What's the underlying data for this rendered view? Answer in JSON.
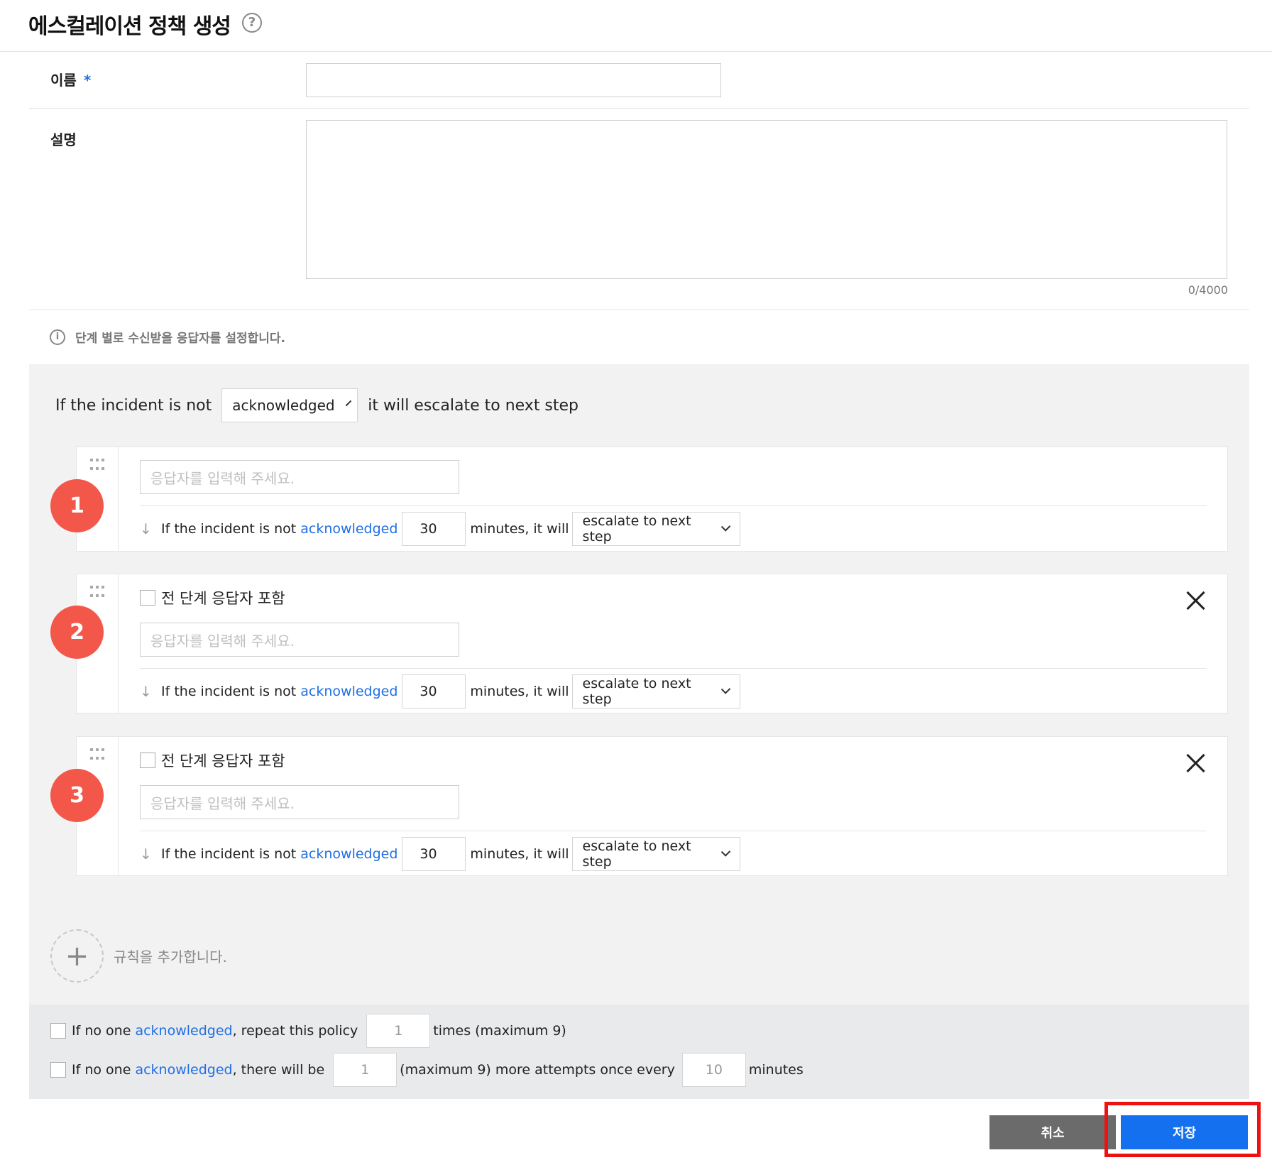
{
  "header": {
    "title": "에스컬레이션 정책 생성",
    "help_icon": "?"
  },
  "form": {
    "name_label": "이름",
    "required_mark": "*",
    "name_value": "",
    "description_label": "설명",
    "description_value": "",
    "char_counter": "0/4000"
  },
  "info": {
    "icon": "i",
    "text": "단계 별로 수신받을 응답자를 설정합니다."
  },
  "policy": {
    "prefix": "If the incident is not",
    "condition_select": "acknowledged",
    "suffix": "it will escalate to next step"
  },
  "steps": [
    {
      "number": "1",
      "responder_placeholder": "응답자를 입력해 주세요.",
      "rule_prefix": "If the incident is not",
      "rule_link": "acknowledged",
      "minutes": "30",
      "rule_middle": "minutes, it will",
      "action": "escalate to next step"
    },
    {
      "number": "2",
      "include_prev_label": "전 단계 응답자 포함",
      "responder_placeholder": "응답자를 입력해 주세요.",
      "rule_prefix": "If the incident is not",
      "rule_link": "acknowledged",
      "minutes": "30",
      "rule_middle": "minutes, it will",
      "action": "escalate to next step"
    },
    {
      "number": "3",
      "include_prev_label": "전 단계 응답자 포함",
      "responder_placeholder": "응답자를 입력해 주세요.",
      "rule_prefix": "If the incident is not",
      "rule_link": "acknowledged",
      "minutes": "30",
      "rule_middle": "minutes, it will",
      "action": "escalate to next step"
    }
  ],
  "add_rule": {
    "icon": "+",
    "label": "규칙을 추가합니다."
  },
  "repeat": {
    "line1_prefix": "If no one",
    "line1_link": "acknowledged",
    "line1_middle": ", repeat this policy",
    "line1_value": "1",
    "line1_suffix": "times (maximum 9)",
    "line2_prefix": "If no one",
    "line2_link": "acknowledged",
    "line2_middle": ", there will be",
    "line2_value": "1",
    "line2_middle2": "(maximum 9) more attempts once every",
    "line2_value2": "10",
    "line2_suffix": "minutes"
  },
  "buttons": {
    "cancel": "취소",
    "save": "저장"
  },
  "colors": {
    "accent": "#1570ef",
    "step_badge": "#f2574a",
    "highlight": "#ee1111",
    "link": "#1f6fe5"
  }
}
